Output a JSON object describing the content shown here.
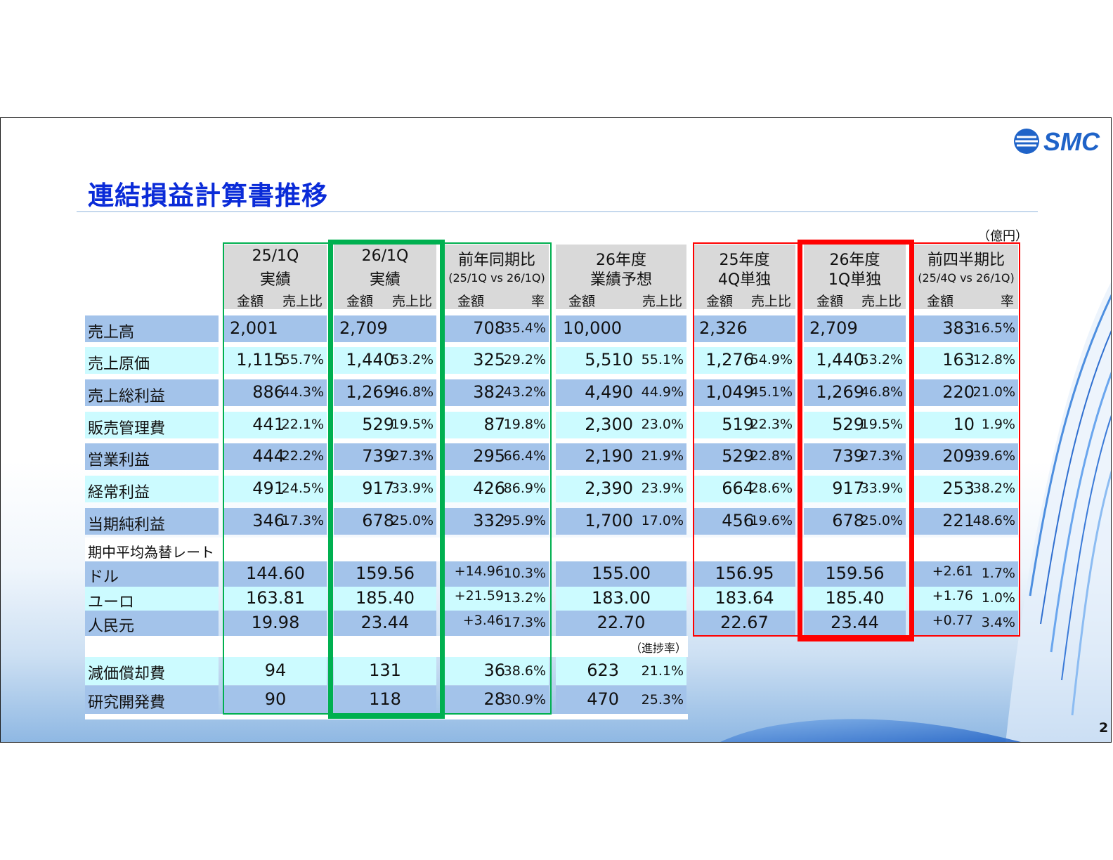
{
  "title": "連結損益計算書推移",
  "unit": "（億円）",
  "page_number": "2",
  "logo_text": "SMC",
  "colors": {
    "title": "#0a2bd8",
    "green_box": "#00b050",
    "red_box": "#ff0000",
    "band_dark": "#a3c3ea",
    "band_light": "#ccfbff",
    "header_bg": "#d9d9d9"
  },
  "groups": [
    {
      "line1": "25/1Q",
      "line2": "実績",
      "sub": "",
      "col_a": "金額",
      "col_b": "売上比"
    },
    {
      "line1": "26/1Q",
      "line2": "実績",
      "sub": "",
      "col_a": "金額",
      "col_b": "売上比"
    },
    {
      "line1": "前年同期比",
      "line2": "",
      "sub": "(25/1Q vs 26/1Q)",
      "col_a": "金額",
      "col_b": "率"
    },
    {
      "line1": "26年度",
      "line2": "業績予想",
      "sub": "",
      "col_a": "金額",
      "col_b": "売上比"
    },
    {
      "line1": "25年度",
      "line2": "4Q単独",
      "sub": "",
      "col_a": "金額",
      "col_b": "売上比"
    },
    {
      "line1": "26年度",
      "line2": "1Q単独",
      "sub": "",
      "col_a": "金額",
      "col_b": "売上比"
    },
    {
      "line1": "前四半期比",
      "line2": "",
      "sub": "(25/4Q vs 26/1Q)",
      "col_a": "金額",
      "col_b": "率"
    }
  ],
  "main_rows": [
    {
      "label": "売上高",
      "cells": [
        [
          "2,001",
          ""
        ],
        [
          "2,709",
          ""
        ],
        [
          "708",
          "35.4%"
        ],
        [
          "10,000",
          ""
        ],
        [
          "2,326",
          ""
        ],
        [
          "2,709",
          ""
        ],
        [
          "383",
          "16.5%"
        ]
      ]
    },
    {
      "label": "売上原価",
      "cells": [
        [
          "1,115",
          "55.7%"
        ],
        [
          "1,440",
          "53.2%"
        ],
        [
          "325",
          "29.2%"
        ],
        [
          "5,510",
          "55.1%"
        ],
        [
          "1,276",
          "54.9%"
        ],
        [
          "1,440",
          "53.2%"
        ],
        [
          "163",
          "12.8%"
        ]
      ]
    },
    {
      "label": "売上総利益",
      "cells": [
        [
          "886",
          "44.3%"
        ],
        [
          "1,269",
          "46.8%"
        ],
        [
          "382",
          "43.2%"
        ],
        [
          "4,490",
          "44.9%"
        ],
        [
          "1,049",
          "45.1%"
        ],
        [
          "1,269",
          "46.8%"
        ],
        [
          "220",
          "21.0%"
        ]
      ]
    },
    {
      "label": "販売管理費",
      "cells": [
        [
          "441",
          "22.1%"
        ],
        [
          "529",
          "19.5%"
        ],
        [
          "87",
          "19.8%"
        ],
        [
          "2,300",
          "23.0%"
        ],
        [
          "519",
          "22.3%"
        ],
        [
          "529",
          "19.5%"
        ],
        [
          "10",
          "1.9%"
        ]
      ]
    },
    {
      "label": "営業利益",
      "cells": [
        [
          "444",
          "22.2%"
        ],
        [
          "739",
          "27.3%"
        ],
        [
          "295",
          "66.4%"
        ],
        [
          "2,190",
          "21.9%"
        ],
        [
          "529",
          "22.8%"
        ],
        [
          "739",
          "27.3%"
        ],
        [
          "209",
          "39.6%"
        ]
      ]
    },
    {
      "label": "経常利益",
      "cells": [
        [
          "491",
          "24.5%"
        ],
        [
          "917",
          "33.9%"
        ],
        [
          "426",
          "86.9%"
        ],
        [
          "2,390",
          "23.9%"
        ],
        [
          "664",
          "28.6%"
        ],
        [
          "917",
          "33.9%"
        ],
        [
          "253",
          "38.2%"
        ]
      ]
    },
    {
      "label": "当期純利益",
      "cells": [
        [
          "346",
          "17.3%"
        ],
        [
          "678",
          "25.0%"
        ],
        [
          "332",
          "95.9%"
        ],
        [
          "1,700",
          "17.0%"
        ],
        [
          "456",
          "19.6%"
        ],
        [
          "678",
          "25.0%"
        ],
        [
          "221",
          "48.6%"
        ]
      ]
    }
  ],
  "fx_label": "期中平均為替レート",
  "fx_rows": [
    {
      "label": "ドル",
      "cells": [
        [
          "144.60",
          ""
        ],
        [
          "159.56",
          ""
        ],
        [
          "+14.96",
          "10.3%"
        ],
        [
          "155.00",
          ""
        ],
        [
          "156.95",
          ""
        ],
        [
          "159.56",
          ""
        ],
        [
          "+2.61",
          "1.7%"
        ]
      ]
    },
    {
      "label": "ユーロ",
      "cells": [
        [
          "163.81",
          ""
        ],
        [
          "185.40",
          ""
        ],
        [
          "+21.59",
          "13.2%"
        ],
        [
          "183.00",
          ""
        ],
        [
          "183.64",
          ""
        ],
        [
          "185.40",
          ""
        ],
        [
          "+1.76",
          "1.0%"
        ]
      ]
    },
    {
      "label": "人民元",
      "cells": [
        [
          "19.98",
          ""
        ],
        [
          "23.44",
          ""
        ],
        [
          "+3.46",
          "17.3%"
        ],
        [
          "22.70",
          ""
        ],
        [
          "22.67",
          ""
        ],
        [
          "23.44",
          ""
        ],
        [
          "+0.77",
          "3.4%"
        ]
      ]
    }
  ],
  "progress_label": "（進捗率）",
  "other_rows": [
    {
      "label": "減価償却費",
      "cells": [
        [
          "94",
          ""
        ],
        [
          "131",
          ""
        ],
        [
          "36",
          "38.6%"
        ],
        [
          "623",
          "21.1%"
        ]
      ]
    },
    {
      "label": "研究開発費",
      "cells": [
        [
          "90",
          ""
        ],
        [
          "118",
          ""
        ],
        [
          "28",
          "30.9%"
        ],
        [
          "470",
          "25.3%"
        ]
      ]
    }
  ]
}
